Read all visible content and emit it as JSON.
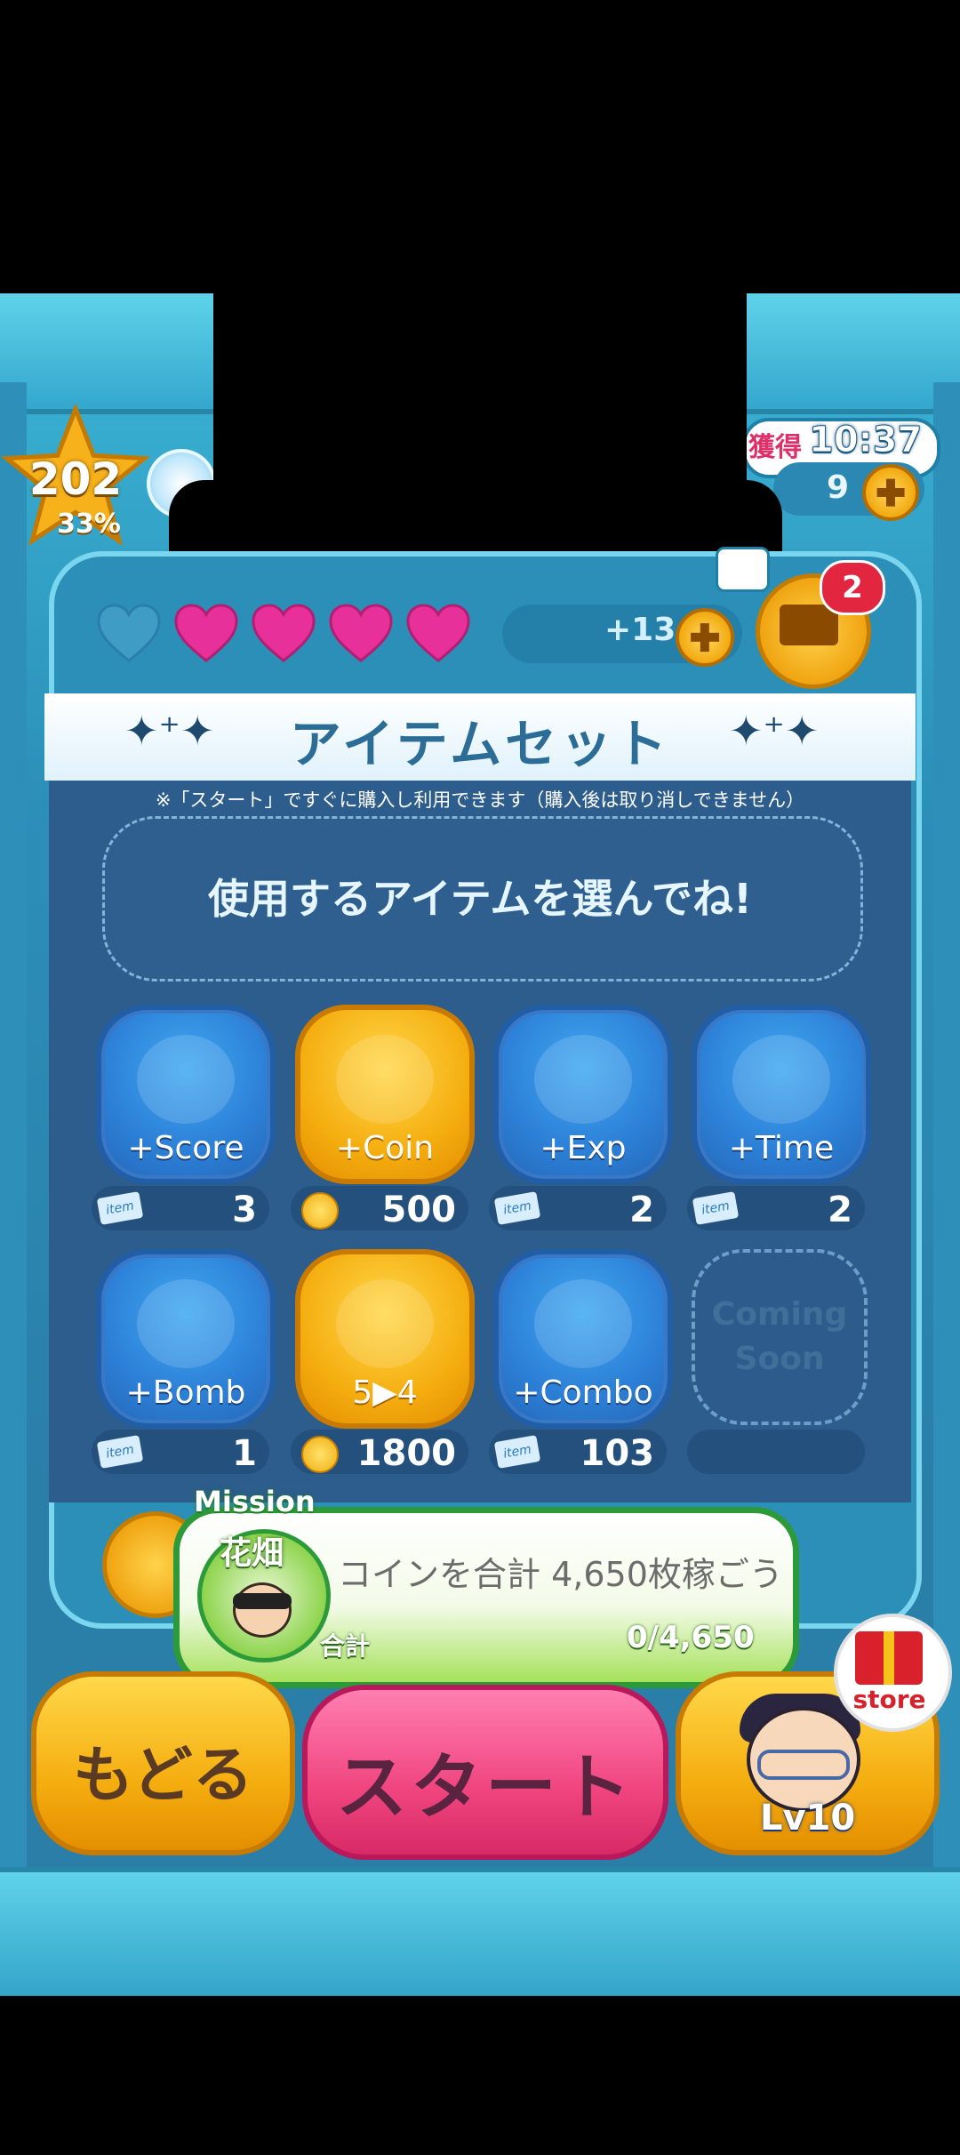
{
  "status": {
    "level": "202",
    "level_progress": "33%",
    "timer_label": "獲得",
    "timer_value": "10:37",
    "coin_count": "9"
  },
  "hearts": {
    "filled": 4,
    "total": 5,
    "extra": "+13"
  },
  "mail": {
    "badge": "2"
  },
  "panel": {
    "title": "アイテムセット",
    "note": "※「スタート」ですぐに購入し利用できます（購入後は取り消しできません）",
    "prompt": "使用するアイテムを選んでね!"
  },
  "items": [
    {
      "label": "+Score",
      "style": "blue",
      "cost_type": "item",
      "count": "3"
    },
    {
      "label": "+Coin",
      "style": "gold",
      "cost_type": "coin",
      "count": "500"
    },
    {
      "label": "+Exp",
      "style": "blue",
      "cost_type": "item",
      "count": "2"
    },
    {
      "label": "+Time",
      "style": "blue",
      "cost_type": "item",
      "count": "2"
    },
    {
      "label": "+Bomb",
      "style": "blue",
      "cost_type": "item",
      "count": "1"
    },
    {
      "label": "5▶4",
      "style": "gold",
      "cost_type": "coin",
      "count": "1800"
    },
    {
      "label": "+Combo",
      "style": "blue",
      "cost_type": "item",
      "count": "103"
    },
    {
      "label": "Coming Soon",
      "style": "soon",
      "cost_type": "none",
      "count": ""
    }
  ],
  "ticket_label": "item",
  "mission": {
    "tag": "Mission",
    "category": "花畑",
    "description": "コインを合計 4,650枚稼ごう",
    "total_label": "合計",
    "progress": "0",
    "goal": "/4,650"
  },
  "buttons": {
    "back": "もどる",
    "start": "スタート",
    "character_level": "Lv10",
    "store": "store"
  },
  "colors": {
    "accent_gold": "#f5ae10",
    "start_pink": "#f0457f",
    "mission_green": "#2d9a3a",
    "heart_pink": "#e8309a"
  }
}
